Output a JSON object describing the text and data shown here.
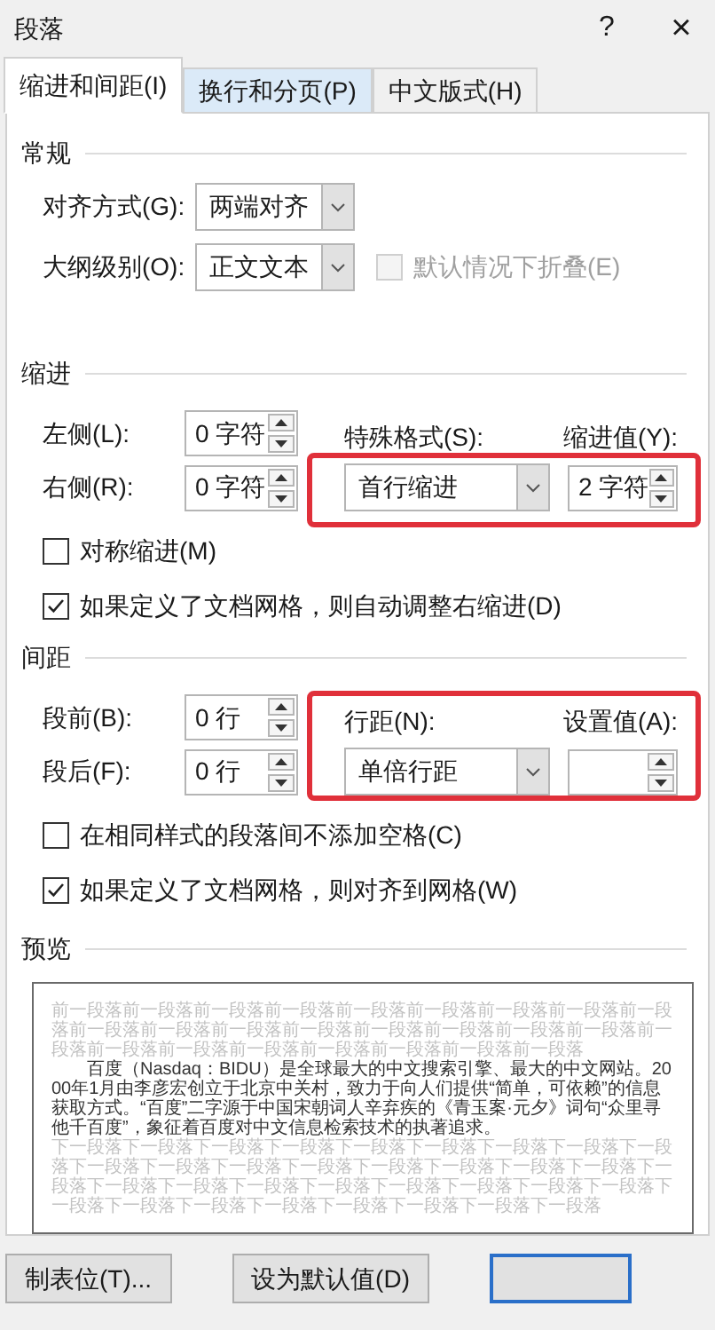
{
  "window": {
    "title": "段落",
    "help_button": "?",
    "close_button": "×"
  },
  "tabs": [
    {
      "label": "缩进和间距(I)",
      "selected": true,
      "hovered": false
    },
    {
      "label": "换行和分页(P)",
      "selected": false,
      "hovered": true
    },
    {
      "label": "中文版式(H)",
      "selected": false,
      "hovered": false
    }
  ],
  "general": {
    "title": "常规",
    "alignment": {
      "label": "对齐方式(G):",
      "value": "两端对齐"
    },
    "outline_level": {
      "label": "大纲级别(O):",
      "value": "正文文本"
    },
    "collapse": {
      "label": "默认情况下折叠(E)",
      "checked": false,
      "disabled": true
    }
  },
  "indent": {
    "title": "缩进",
    "left": {
      "label": "左侧(L):",
      "value": "0 字符"
    },
    "right": {
      "label": "右侧(R):",
      "value": "0 字符"
    },
    "special": {
      "label": "特殊格式(S):",
      "value": "首行缩进"
    },
    "by": {
      "label": "缩进值(Y):",
      "value": "2 字符"
    },
    "options": [
      {
        "label": "对称缩进(M)",
        "checked": false,
        "disabled": false
      },
      {
        "label": "如果定义了文档网格，则自动调整右缩进(D)",
        "checked": true,
        "disabled": false
      }
    ]
  },
  "spacing": {
    "title": "间距",
    "before": {
      "label": "段前(B):",
      "value": "0 行"
    },
    "after": {
      "label": "段后(F):",
      "value": "0 行"
    },
    "line_spacing": {
      "label": "行距(N):",
      "value": "单倍行距"
    },
    "at": {
      "label": "设置值(A):"
    },
    "options": [
      {
        "label": "在相同样式的段落间不添加空格(C)",
        "checked": false,
        "disabled": false
      },
      {
        "label": "如果定义了文档网格，则对齐到网格(W)",
        "checked": true,
        "disabled": false
      }
    ]
  },
  "preview": {
    "title": "预览",
    "previous_text": "前一段落前一段落前一段落前一段落前一段落前一段落前一段落前一段落前一段落前一段落前一段落前一段落前一段落前一段落前一段落前一段落前一段落前一段落前一段落前一段落前一段落前一段落前一段落前一段落前一段落",
    "sample_text": "百度（Nasdaq：BIDU）是全球最大的中文搜索引擎、最大的中文网站。2000年1月由李彦宏创立于北京中关村，致力于向人们提供“简单，可依赖”的信息获取方式。“百度”二字源于中国宋朝词人辛弃疾的《青玉案·元夕》词句“众里寻他千百度”，象征着百度对中文信息检索技术的执著追求。",
    "next_text": "下一段落下一段落下一段落下一段落下一段落下一段落下一段落下一段落下一段落下一段落下一段落下一段落下一段落下一段落下一段落下一段落下一段落下一段落下一段落下一段落下一段落下一段落下一段落下一段落下一段落下一段落下一段落下一段落下一段落下一段落下一段落下一段落下一段落下一段落"
  },
  "buttons": [
    {
      "label": "制表位(T)...",
      "default": false
    },
    {
      "label": "设为默认值(D)",
      "default": false
    },
    {
      "default": true
    }
  ]
}
